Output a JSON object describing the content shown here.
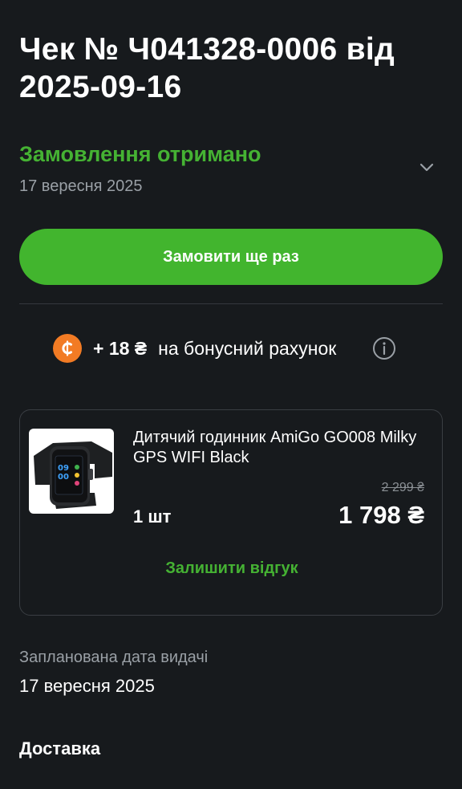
{
  "header": {
    "title": "Чек № Ч041328-0006 від 2025-09-16"
  },
  "order_status": {
    "title": "Замовлення отримано",
    "date": "17 вересня 2025",
    "expand_icon": "chevron-down-icon"
  },
  "actions": {
    "reorder_label": "Замовити ще раз"
  },
  "bonus": {
    "icon": "coin-icon",
    "amount": "+ 18 ₴",
    "text": "на бонусний рахунок",
    "info_icon": "info-icon"
  },
  "product": {
    "name": "Дитячий годинник AmiGo GO008 Milky GPS WIFI Black",
    "quantity": "1 шт",
    "old_price": "2 299 ₴",
    "price": "1 798 ₴",
    "review_label": "Залишити відгук",
    "watch_time": "09 00"
  },
  "issue": {
    "label": "Запланована дата видачі",
    "date": "17 вересня 2025"
  },
  "delivery": {
    "title": "Доставка"
  },
  "colors": {
    "background": "#171a1d",
    "accent_green": "#42b52e",
    "status_green": "#45b233",
    "coin_orange": "#f27b24",
    "muted_text": "#9aa0a6"
  }
}
